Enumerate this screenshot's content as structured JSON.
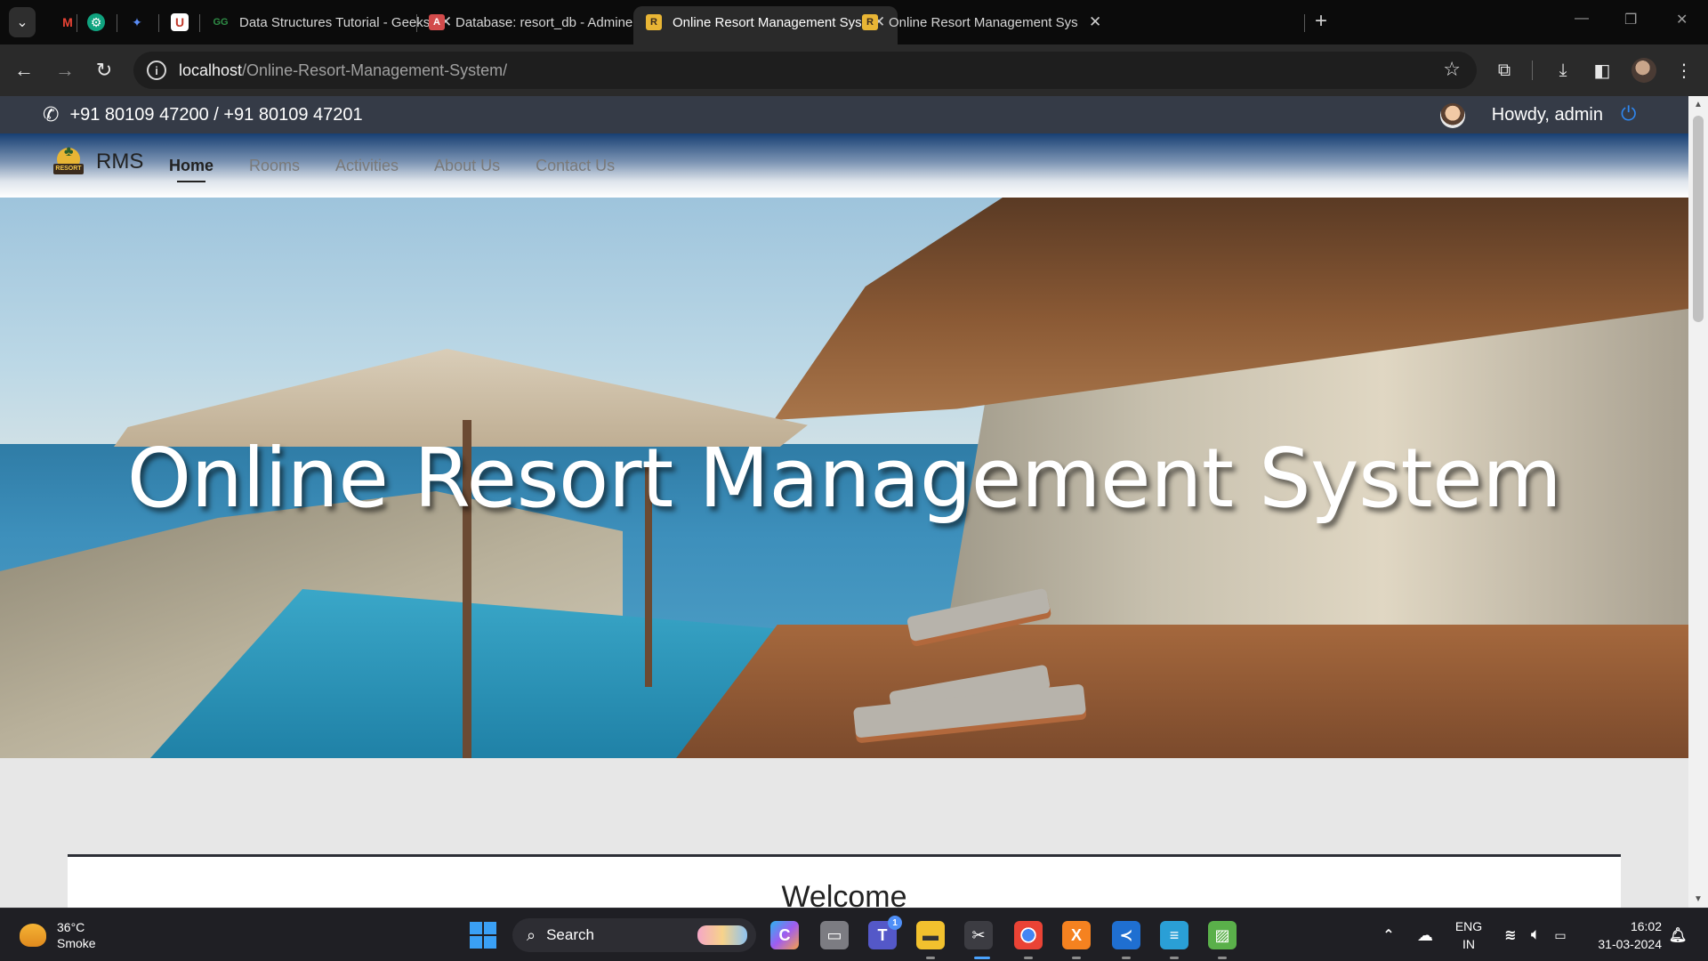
{
  "browser": {
    "tabs": [
      {
        "title": "Data Structures Tutorial - Geeks",
        "favicon": "geeksforgeeks-icon",
        "active": false
      },
      {
        "title": "Database: resort_db - Adminer",
        "favicon": "adminer-icon",
        "active": false
      },
      {
        "title": "Online Resort Management Sys",
        "favicon": "resort-icon",
        "active": true
      },
      {
        "title": "Online Resort Management Sys",
        "favicon": "resort-icon",
        "active": false
      }
    ],
    "pinned_tabs": [
      "gmail-icon",
      "chatgpt-icon",
      "gemini-icon",
      "app-icon"
    ],
    "url_host": "localhost",
    "url_path": "/Online-Resort-Management-System/",
    "accent": "#2a2a2a"
  },
  "site": {
    "topbar": {
      "phone": "+91 80109 47200 / +91 80109 47201",
      "greeting": "Howdy, admin"
    },
    "brand": "RMS",
    "nav": [
      {
        "label": "Home",
        "active": true
      },
      {
        "label": "Rooms",
        "active": false
      },
      {
        "label": "Activities",
        "active": false
      },
      {
        "label": "About Us",
        "active": false
      },
      {
        "label": "Contact Us",
        "active": false
      }
    ],
    "hero_title": "Online Resort Management System",
    "welcome": "Welcome",
    "logo_text": "RESORT",
    "colors": {
      "topbar_bg": "#353b47",
      "power_icon": "#2f87f0",
      "nav_top": "#173f73"
    }
  },
  "taskbar": {
    "weather_temp": "36°C",
    "weather_desc": "Smoke",
    "search_label": "Search",
    "teams_badge": "1",
    "lang_top": "ENG",
    "lang_bottom": "IN",
    "time": "16:02",
    "date": "31-03-2024"
  }
}
